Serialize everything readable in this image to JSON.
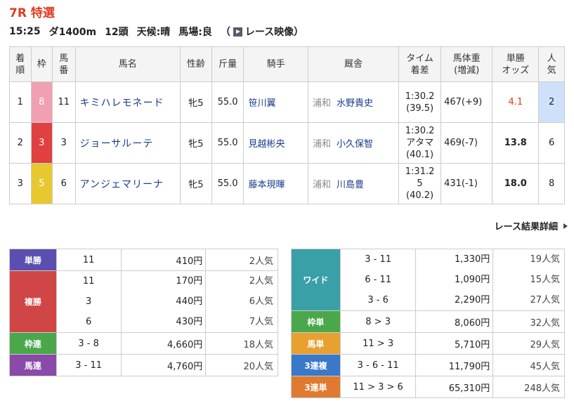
{
  "race": {
    "title": "7R 特選",
    "time": "15:25",
    "course": "ダ1400m",
    "heads": "12頭",
    "weather": "天候:晴",
    "track": "馬場:良",
    "video_open": "（",
    "video_label": "レース映像",
    "video_close": "）",
    "play_icon": "play-icon"
  },
  "results_table": {
    "headers": {
      "rank_1": "着",
      "rank_2": "順",
      "frame": "枠",
      "num_1": "馬",
      "num_2": "番",
      "name": "馬名",
      "sex_age": "性齢",
      "weight": "斤量",
      "jockey": "騎手",
      "stable": "厩舎",
      "time_1": "タイム",
      "time_2": "着差",
      "body_1": "馬体重",
      "body_2": "(増減)",
      "odds_1": "単勝",
      "odds_2": "オッズ",
      "pop_1": "人",
      "pop_2": "気"
    },
    "rows": [
      {
        "rank": "1",
        "frame": "8",
        "frame_color": "#f0a0b0",
        "number": "11",
        "name": "キミハレモネード",
        "sex_age": "牝5",
        "weight": "55.0",
        "jockey": "笹川翼",
        "area": "浦和",
        "trainer": "水野貴史",
        "time": "1:30.2",
        "margin": "(39.5)",
        "body": "467(+9)",
        "odds": "4.1",
        "popularity": "2"
      },
      {
        "rank": "2",
        "frame": "3",
        "frame_color": "#e04040",
        "number": "3",
        "name": "ジョーサルーテ",
        "sex_age": "牝5",
        "weight": "55.0",
        "jockey": "見越彬央",
        "area": "浦和",
        "trainer": "小久保智",
        "time": "1:30.2",
        "margin": "アタマ",
        "margin2": "(40.1)",
        "body": "469(-7)",
        "odds": "13.8",
        "popularity": "6"
      },
      {
        "rank": "3",
        "frame": "5",
        "frame_color": "#e8c830",
        "number": "6",
        "name": "アンジェマリーナ",
        "sex_age": "牝5",
        "weight": "55.0",
        "jockey": "藤本現暉",
        "area": "浦和",
        "trainer": "川島豊",
        "time": "1:31.2",
        "margin": "5",
        "margin2": "(40.2)",
        "body": "431(-1)",
        "odds": "18.0",
        "popularity": "8"
      }
    ]
  },
  "detail_link": "レース結果詳細",
  "payouts_left": [
    {
      "label": "単勝",
      "color": "#5a4fb0",
      "lines": [
        {
          "combo": "11",
          "yen": "410円",
          "pop": "2人気"
        }
      ]
    },
    {
      "label": "複勝",
      "color": "#d04545",
      "lines": [
        {
          "combo": "11",
          "yen": "170円",
          "pop": "2人気"
        },
        {
          "combo": "3",
          "yen": "440円",
          "pop": "6人気"
        },
        {
          "combo": "6",
          "yen": "430円",
          "pop": "7人気"
        }
      ]
    },
    {
      "label": "枠連",
      "color": "#4aa84a",
      "lines": [
        {
          "combo": "3 - 8",
          "yen": "4,660円",
          "pop": "18人気"
        }
      ]
    },
    {
      "label": "馬連",
      "color": "#8a4aa8",
      "lines": [
        {
          "combo": "3 - 11",
          "yen": "4,760円",
          "pop": "20人気"
        }
      ]
    }
  ],
  "payouts_right": [
    {
      "label": "ワイド",
      "color": "#3aa0a8",
      "lines": [
        {
          "combo": "3 - 11",
          "yen": "1,330円",
          "pop": "19人気"
        },
        {
          "combo": "6 - 11",
          "yen": "1,090円",
          "pop": "15人気"
        },
        {
          "combo": "3 - 6",
          "yen": "2,290円",
          "pop": "27人気"
        }
      ]
    },
    {
      "label": "枠単",
      "color": "#4aa84a",
      "lines": [
        {
          "combo": "8 > 3",
          "yen": "8,060円",
          "pop": "32人気"
        }
      ]
    },
    {
      "label": "馬単",
      "color": "#e8a030",
      "lines": [
        {
          "combo": "11 > 3",
          "yen": "5,710円",
          "pop": "29人気"
        }
      ]
    },
    {
      "label": "3連複",
      "color": "#3a78c8",
      "lines": [
        {
          "combo": "3 - 6 - 11",
          "yen": "11,790円",
          "pop": "45人気"
        }
      ]
    },
    {
      "label": "3連単",
      "color": "#e07a30",
      "lines": [
        {
          "combo": "11 > 3 > 6",
          "yen": "65,310円",
          "pop": "248人気"
        }
      ]
    }
  ]
}
